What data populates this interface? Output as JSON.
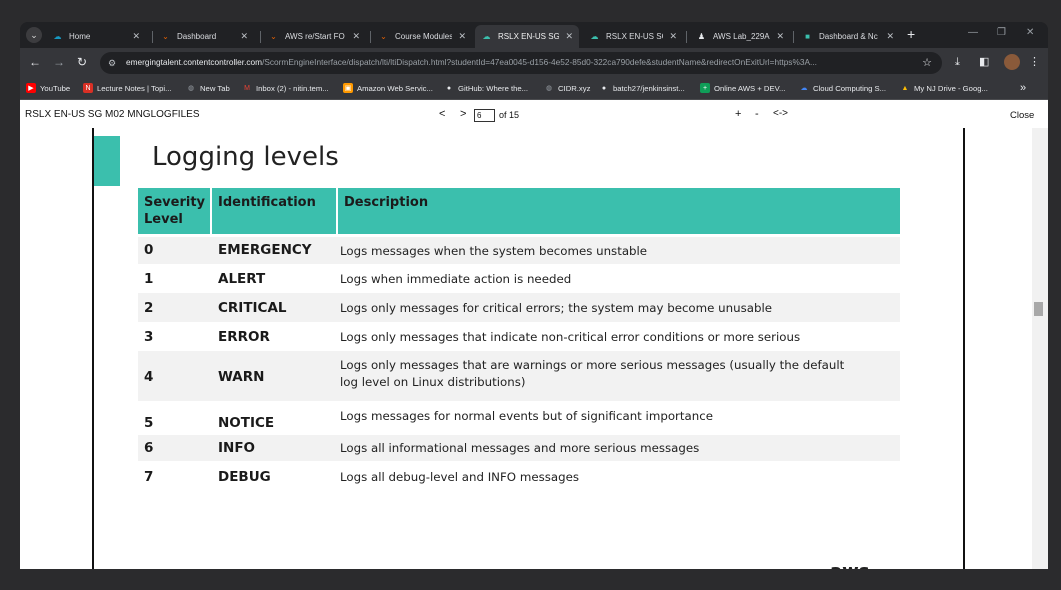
{
  "browser": {
    "tabs": [
      {
        "label": "Home",
        "icon": "salesforce-cloud-icon",
        "active": false
      },
      {
        "label": "Dashboard",
        "icon": "canvas-icon",
        "active": false
      },
      {
        "label": "AWS re/Start FO",
        "icon": "canvas-icon",
        "active": false
      },
      {
        "label": "Course Modules",
        "icon": "canvas-icon",
        "active": false
      },
      {
        "label": "RSLX EN-US SG I",
        "icon": "aws-icon",
        "active": true
      },
      {
        "label": "RSLX EN-US SG I",
        "icon": "aws-icon",
        "active": false
      },
      {
        "label": "AWS Lab_229AN",
        "icon": "lab-icon",
        "active": false
      },
      {
        "label": "Dashboard & Nc",
        "icon": "dashboard-icon",
        "active": false
      }
    ],
    "new_tab": "+",
    "url_host": "emergingtalent.contentcontroller.com",
    "url_path": "/ScormEngineInterface/dispatch/lti/ltiDispatch.html?studentId=47ea0045-d156-4e52-85d0-322ca790defe&studentName&redirectOnExitUrl=https%3A...",
    "bookmarks": [
      {
        "label": "YouTube",
        "icon": "youtube-icon",
        "color": "#ff0000"
      },
      {
        "label": "Lecture Notes | Topi...",
        "icon": "notes-icon",
        "color": "#d93025"
      },
      {
        "label": "New Tab",
        "icon": "globe-icon",
        "color": "#9aa0a6"
      },
      {
        "label": "Inbox (2) - nitin.tem...",
        "icon": "gmail-icon",
        "color": "#ea4335"
      },
      {
        "label": "Amazon Web Servic...",
        "icon": "aws-icon",
        "color": "#ff9900"
      },
      {
        "label": "GitHub: Where the...",
        "icon": "github-icon",
        "color": "#e8eaed"
      },
      {
        "label": "CIDR.xyz",
        "icon": "globe-icon",
        "color": "#9aa0a6"
      },
      {
        "label": "batch27/jenkinsinst...",
        "icon": "github-icon",
        "color": "#e8eaed"
      },
      {
        "label": "Online AWS + DEV...",
        "icon": "sheets-icon",
        "color": "#0f9d58"
      },
      {
        "label": "Cloud Computing S...",
        "icon": "cloud-icon",
        "color": "#4285f4"
      },
      {
        "label": "My NJ Drive - Goog...",
        "icon": "drive-icon",
        "color": "#fbbc04"
      }
    ],
    "bookmarks_more": "»"
  },
  "viewer": {
    "doc_title": "RSLX EN-US SG M02 MNGLOGFILES",
    "prev": "<",
    "next": ">",
    "page": "6",
    "of_total": "of 15",
    "zoom_in": "+",
    "zoom_out": "-",
    "fit": "<->",
    "close": "Close"
  },
  "slide": {
    "title": "Logging levels",
    "accent_color": "#3bbfad",
    "headers": {
      "level": "Severity Level",
      "identification": "Identification",
      "description": "Description"
    },
    "rows": [
      {
        "level": "0",
        "id": "EMERGENCY",
        "desc": "Logs messages when the system becomes unstable"
      },
      {
        "level": "1",
        "id": "ALERT",
        "desc": "Logs when immediate action is needed"
      },
      {
        "level": "2",
        "id": "CRITICAL",
        "desc": "Logs only messages for critical errors; the system may become unusable"
      },
      {
        "level": "3",
        "id": "ERROR",
        "desc": "Logs only messages that indicate non-critical error conditions or more serious messages"
      },
      {
        "level": "4",
        "id": "WARN",
        "desc": "Logs only messages that are warnings or more serious messages (usually the default log level on Linux distributions)"
      },
      {
        "level": "5",
        "id": "NOTICE",
        "desc": "Logs messages for normal events but of significant importance"
      },
      {
        "level": "6",
        "id": "INFO",
        "desc": "Logs all informational messages and more serious messages"
      },
      {
        "level": "7",
        "id": "DEBUG",
        "desc": "Logs all debug-level and INFO messages"
      }
    ],
    "logo_text": "aws"
  }
}
